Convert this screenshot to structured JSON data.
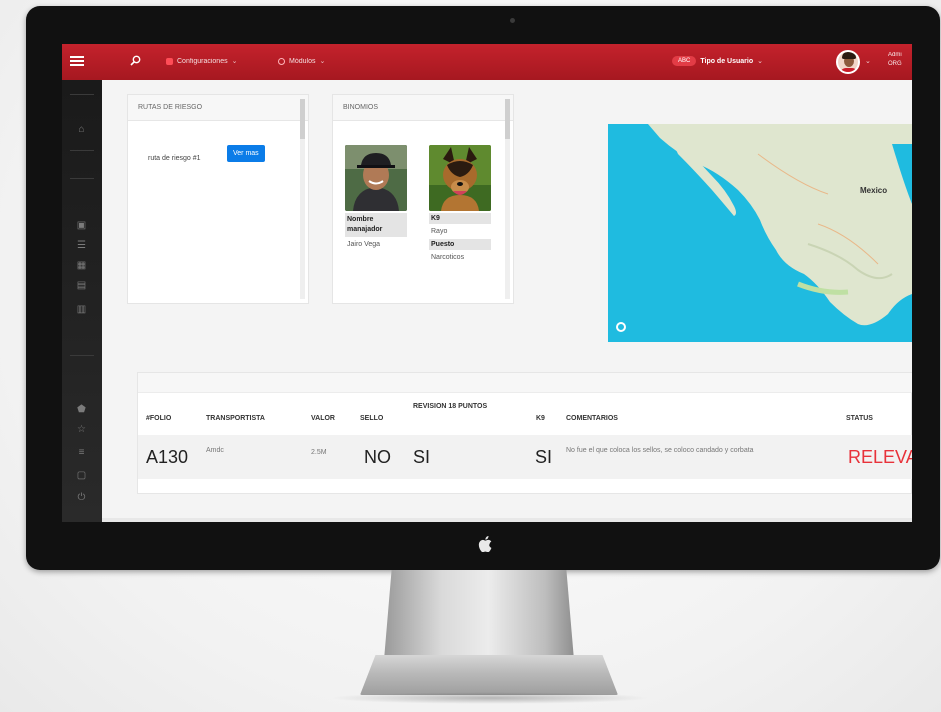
{
  "topbar": {
    "menu_icon": "hamburger-icon",
    "search_icon": "search-icon",
    "nav_1": "Configuraciones",
    "nav_2": "Módulos",
    "pill_label": "ABC",
    "user_type": "Tipo de Usuario",
    "user_name": "Admi",
    "user_sub": "ORG"
  },
  "sidebar": {
    "icons": [
      "home-icon",
      "book-icon",
      "list-icon",
      "grid-icon",
      "table-icon",
      "calendar-icon",
      "shield-icon",
      "star-icon",
      "menu-icon",
      "chat-icon",
      "power-icon"
    ]
  },
  "rutas": {
    "title": "RUTAS DE RIESGO",
    "route_text": "ruta de riesgo #1",
    "button_label": "Ver mas"
  },
  "binomios": {
    "title": "BINOMIOS",
    "handler_label": "Nombre manajador",
    "handler_name": "Jairo Vega",
    "k9_label": "K9",
    "k9_name": "Rayo",
    "position_label": "Puesto",
    "position_value": "Narcoticos"
  },
  "map": {
    "country_label": "Mexico"
  },
  "table": {
    "headers": [
      "#FOLIO",
      "TRANSPORTISTA",
      "VALOR",
      "SELLO",
      "REVISION 18 PUNTOS",
      "K9",
      "COMENTARIOS",
      "STATUS"
    ],
    "row": {
      "folio": "A130",
      "transportista": "Amdc",
      "valor": "2.5M",
      "sello": "NO",
      "revision": "SI",
      "k9": "SI",
      "comentarios": "No fue el que coloca los sellos, se coloco candado y corbata",
      "status": "RELEVA"
    }
  },
  "colors": {
    "topbar": "#b81d26",
    "status_red": "#e8323a",
    "button_blue": "#0b7ce8",
    "ocean": "#1fbbe0"
  }
}
